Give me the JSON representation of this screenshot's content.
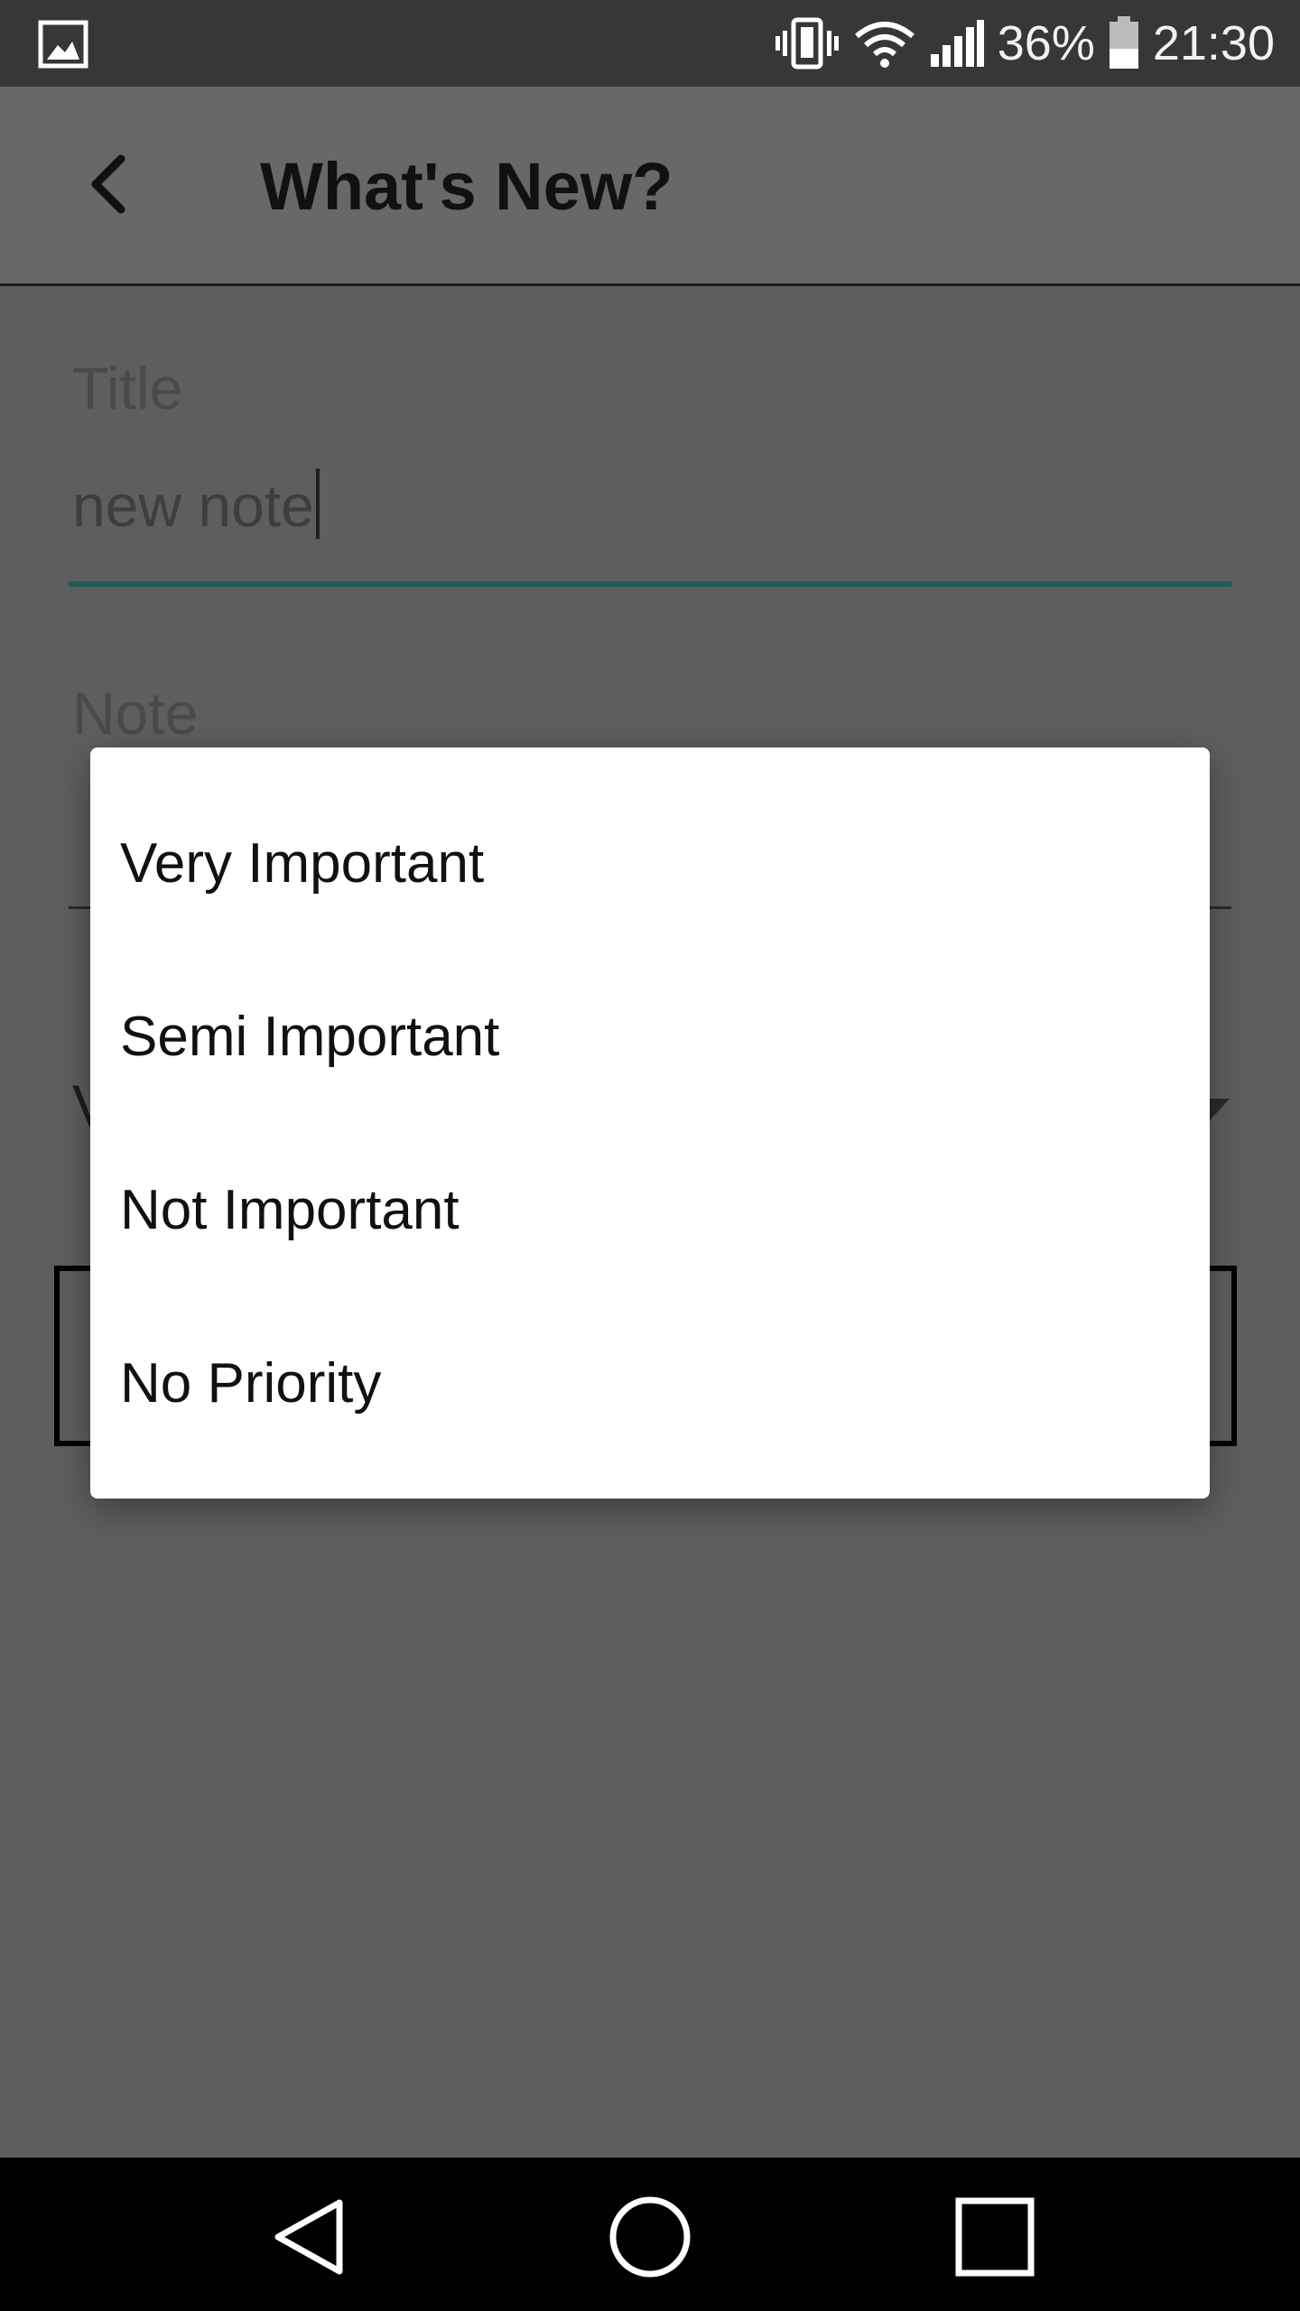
{
  "status_bar": {
    "battery": "36%",
    "time": "21:30",
    "icons": [
      "gallery-notification-icon",
      "vibrate-icon",
      "wifi-icon",
      "signal-icon",
      "battery-icon"
    ]
  },
  "app_bar": {
    "title": "What's New?",
    "back_icon": "chevron-left-icon"
  },
  "form": {
    "title_label": "Title",
    "title_value": "new note",
    "note_label": "Note",
    "priority_partial": "V"
  },
  "priority_popup": {
    "options": [
      "Very Important",
      "Semi Important",
      "Not Important",
      "No Priority"
    ]
  },
  "nav_bar": {
    "icons": [
      "back-triangle-icon",
      "home-circle-icon",
      "recents-square-icon"
    ]
  },
  "colors": {
    "accent": "#1f5c55",
    "scrim_background": "#5e5e60",
    "popup_background": "#ffffff"
  }
}
